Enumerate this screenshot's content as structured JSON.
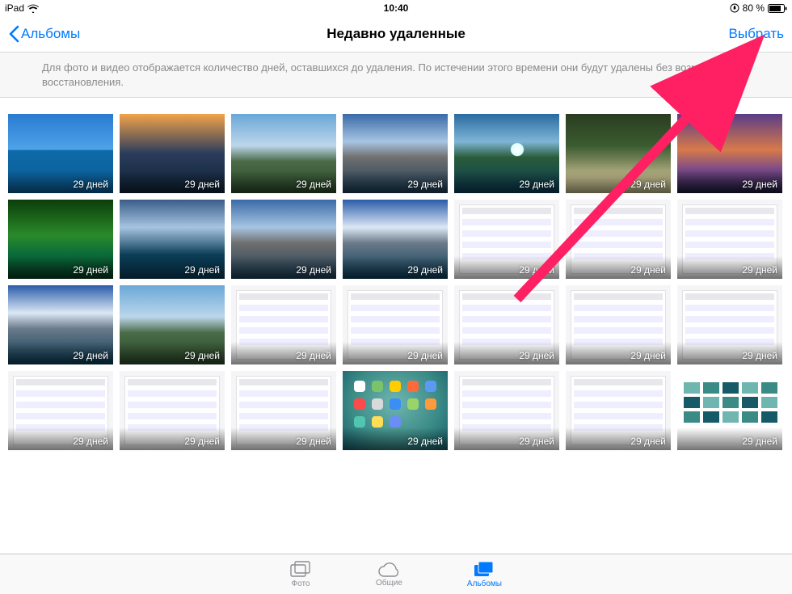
{
  "status": {
    "device": "iPad",
    "time": "10:40",
    "battery_pct": "80 %"
  },
  "nav": {
    "back_label": "Альбомы",
    "title": "Недавно удаленные",
    "select_label": "Выбрать"
  },
  "banner": {
    "text": "Для фото и видео отображается количество дней, оставшихся до удаления. По истечении этого времени они будут удалены без возможности восстановления."
  },
  "days_label": "29 дней",
  "thumbs": [
    {
      "kind": "sky-sea"
    },
    {
      "kind": "pier"
    },
    {
      "kind": "mtn1"
    },
    {
      "kind": "mtn2"
    },
    {
      "kind": "lake"
    },
    {
      "kind": "road"
    },
    {
      "kind": "sunset"
    },
    {
      "kind": "green"
    },
    {
      "kind": "clouds"
    },
    {
      "kind": "mtn2"
    },
    {
      "kind": "snow"
    },
    {
      "kind": "appshot"
    },
    {
      "kind": "appshot"
    },
    {
      "kind": "appshot"
    },
    {
      "kind": "snow"
    },
    {
      "kind": "mtn1"
    },
    {
      "kind": "appshot"
    },
    {
      "kind": "appshot"
    },
    {
      "kind": "appshot"
    },
    {
      "kind": "appshot"
    },
    {
      "kind": "appshot"
    },
    {
      "kind": "appshot"
    },
    {
      "kind": "appshot"
    },
    {
      "kind": "appshot"
    },
    {
      "kind": "homescr"
    },
    {
      "kind": "appshot"
    },
    {
      "kind": "appshot"
    },
    {
      "kind": "gallery"
    }
  ],
  "tabs": {
    "photos": "Фото",
    "shared": "Общие",
    "albums": "Альбомы"
  }
}
